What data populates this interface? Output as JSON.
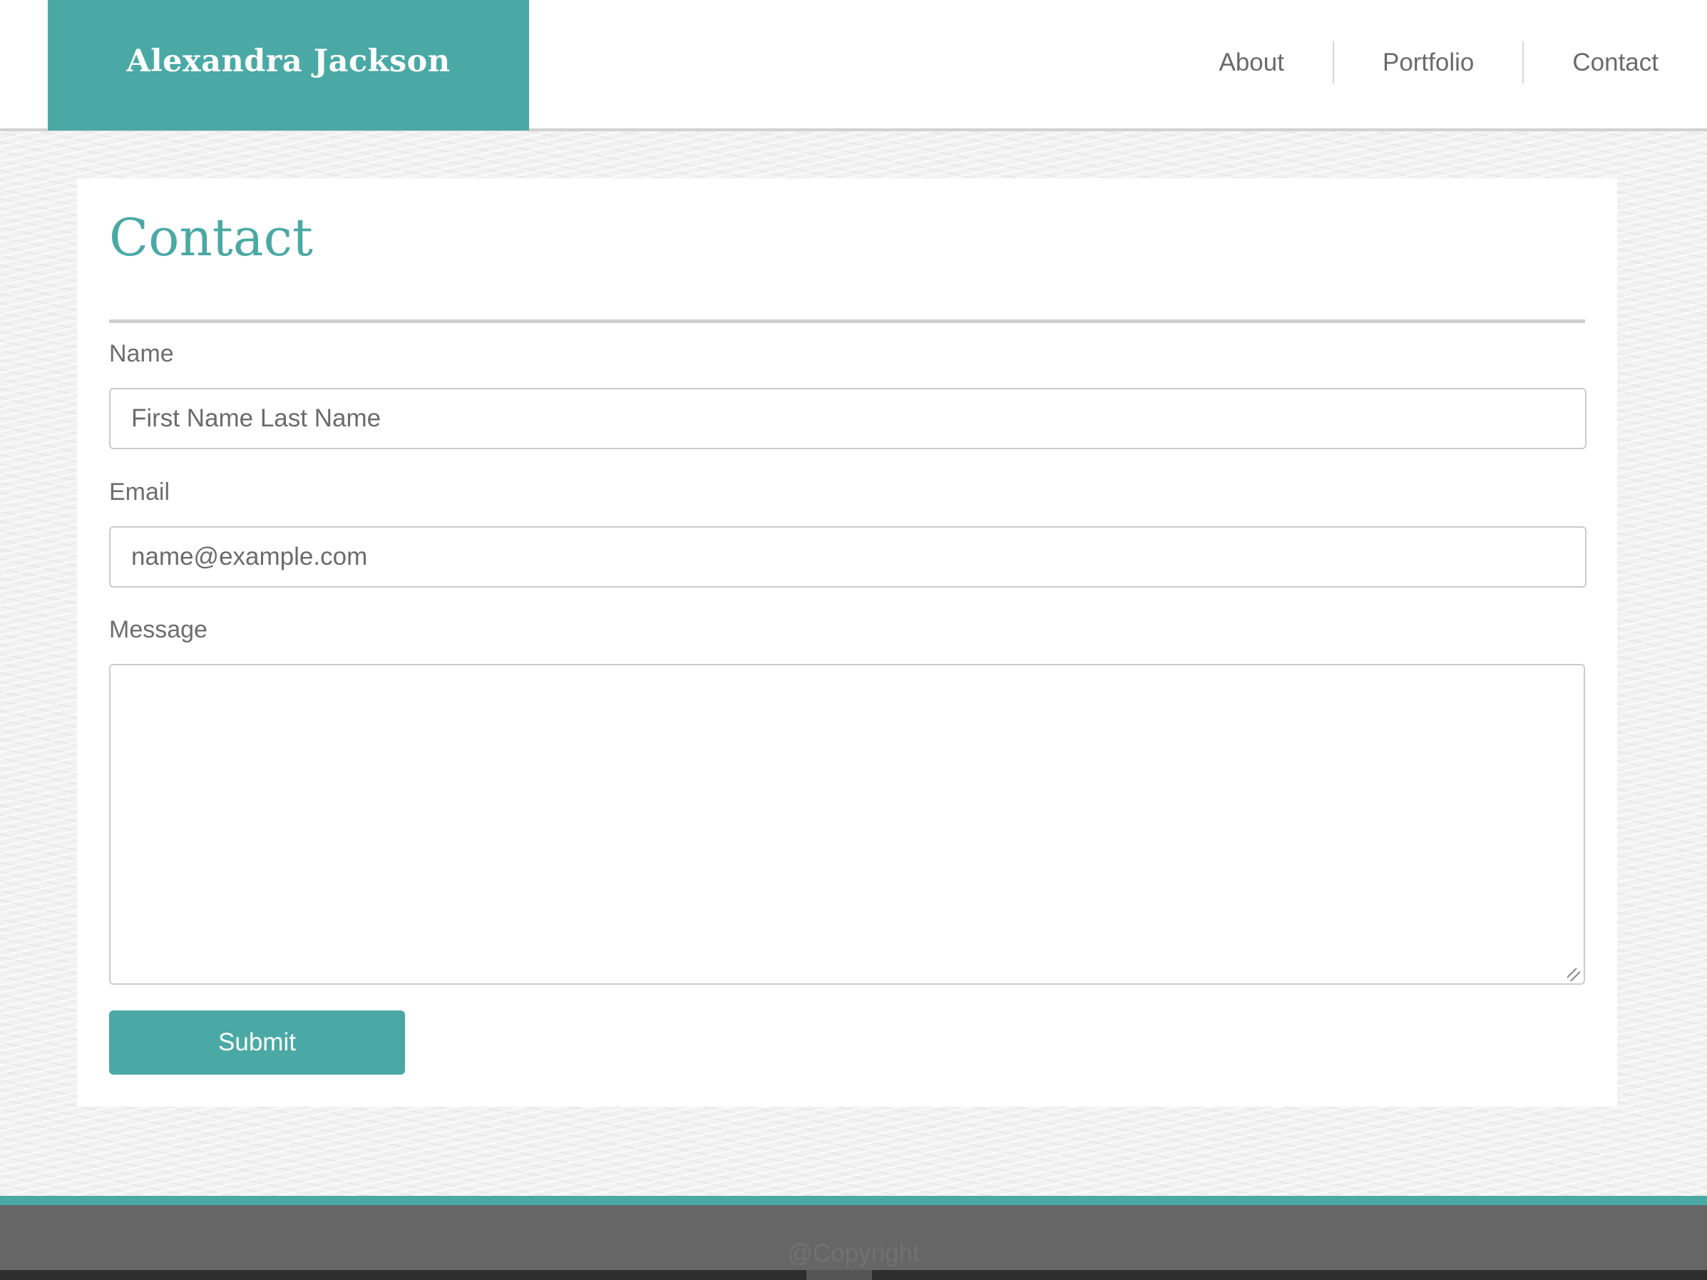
{
  "header": {
    "brand_name": "Alexandra Jackson",
    "nav": [
      {
        "label": "About"
      },
      {
        "label": "Portfolio"
      },
      {
        "label": "Contact"
      }
    ]
  },
  "main": {
    "title": "Contact",
    "form": {
      "name_label": "Name",
      "name_value": "",
      "name_placeholder": "First Name Last Name",
      "email_label": "Email",
      "email_value": "",
      "email_placeholder": "name@example.com",
      "message_label": "Message",
      "message_value": "",
      "submit_label": "Submit"
    }
  },
  "footer": {
    "copyright": "@Copyright"
  },
  "colors": {
    "accent": "#4aa9a5",
    "footer_bg": "#666666",
    "text_muted": "#6d6d6d",
    "rule": "#cfcfcf"
  }
}
